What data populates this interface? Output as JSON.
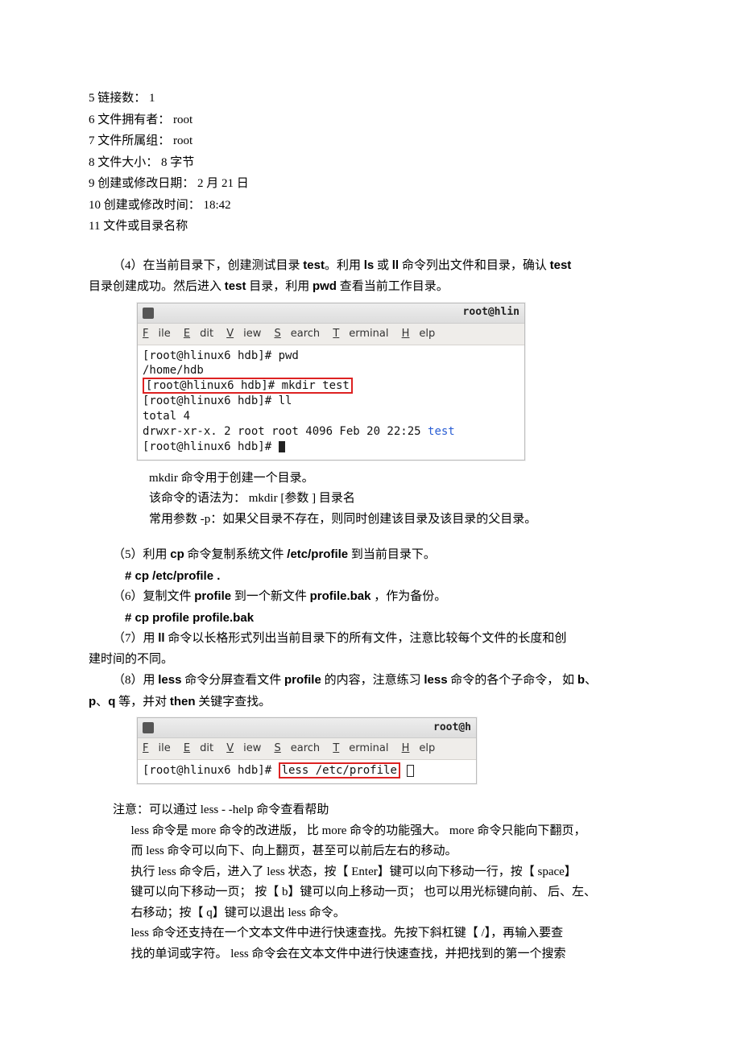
{
  "list": {
    "i5": "5 链接数：    1",
    "i6": "6 文件拥有者：    root",
    "i7": "7 文件所属组：    root",
    "i8": "8 文件大小：      8 字节",
    "i9": "9 创建或修改日期：    2 月 21 日",
    "i10": "10 创建或修改时间：    18:42",
    "i11": "11 文件或目录名称"
  },
  "p4": {
    "a": "（4）在当前目录下，创建测试目录",
    "b": "test",
    "c": "。利用",
    "d": "ls",
    "e": "或",
    "f": "ll",
    "g": "命令列出文件和目录，确认",
    "h": "test",
    "i": "目录创建成功。然后进入",
    "j": "test",
    "k": "目录，利用",
    "l": "pwd",
    "m": "查看当前工作目录。"
  },
  "term1": {
    "title": "root@hlin",
    "menu": {
      "file": "File",
      "edit": "Edit",
      "view": "View",
      "search": "Search",
      "terminal": "Terminal",
      "help": "Help"
    },
    "l1": "[root@hlinux6 hdb]# pwd",
    "l2": "/home/hdb",
    "l3": "[root@hlinux6 hdb]# mkdir test",
    "l4": "[root@hlinux6 hdb]# ll",
    "l5": "total 4",
    "l6a": "drwxr-xr-x. 2 root root 4096 Feb 20 22:25 ",
    "l6b": "test",
    "l7": "[root@hlinux6 hdb]# "
  },
  "mkdir": {
    "a": "mkdir 命令用于创建一个目录。",
    "b": "该命令的语法为：   mkdir    [参数 ]    目录名",
    "c": "常用参数    -p：如果父目录不存在，则同时创建该目录及该目录的父目录。"
  },
  "p5": {
    "a": "（5）利用",
    "b": "cp",
    "c": "命令复制系统文件",
    "d": "/etc/profile",
    "e": "到当前目录下。",
    "cmd": "# cp /etc/profile ."
  },
  "p6": {
    "a": "（6）复制文件",
    "b": "profile",
    "c": "到一个新文件",
    "d": "profile.bak",
    "e": "，作为备份。",
    "cmd": "# cp profile profile.bak"
  },
  "p7": {
    "a": "（7）用",
    "b": "ll",
    "c": "命令以长格形式列出当前目录下的所有文件，注意比较每个文件的长度和创",
    "d": "建时间的不同。"
  },
  "p8": {
    "a": "（8）用",
    "b": "less",
    "c": "命令分屏查看文件",
    "d": "profile",
    "e": "的内容，注意练习",
    "f": "less",
    "g": "命令的各个子命令，   如",
    "h": "b",
    "i": "、",
    "j": "p",
    "k": "、",
    "l": "q",
    "m": "等，并对",
    "n": "then",
    "o": "关键字查找。"
  },
  "term2": {
    "title": "root@h",
    "menu": {
      "file": "File",
      "edit": "Edit",
      "view": "View",
      "search": "Search",
      "terminal": "Terminal",
      "help": "Help"
    },
    "l1a": "[root@hlinux6 hdb]# ",
    "l1b": "less /etc/profile"
  },
  "note": {
    "head": "注意：可以通过   less  - -help  命令查看帮助",
    "a": "less 命令是   more 命令的改进版，  比 more 命令的功能强大。   more 命令只能向下翻页，",
    "b": "而 less 命令可以向下、向上翻页，甚至可以前后左右的移动。",
    "c": "执行 less 命令后，进入了   less 状态，按【  Enter】键可以向下移动一行，按【       space】",
    "d": "键可以向下移动一页；   按【 b】键可以向上移动一页；    也可以用光标键向前、   后、左、",
    "e": "右移动；按【  q】键可以退出   less 命令。",
    "f": " less 命令还支持在一个文本文件中进行快速查找。先按下斜杠键【           /】，再输入要查",
    "g": "找的单词或字符。   less  命令会在文本文件中进行快速查找，并把找到的第一个搜索"
  }
}
